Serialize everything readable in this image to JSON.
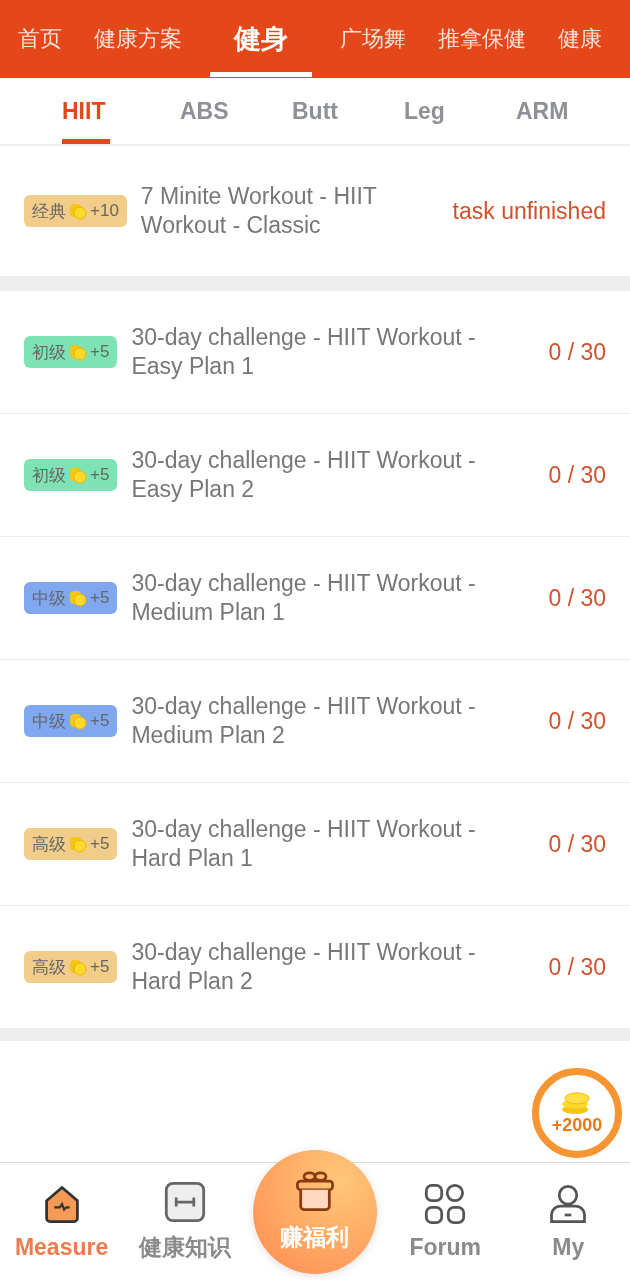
{
  "top_tabs": [
    {
      "label": "首页",
      "selected": false
    },
    {
      "label": "健康方案",
      "selected": false
    },
    {
      "label": "健身",
      "selected": true
    },
    {
      "label": "广场舞",
      "selected": false
    },
    {
      "label": "推拿保健",
      "selected": false
    },
    {
      "label": "健康",
      "selected": false
    }
  ],
  "sub_tabs": [
    {
      "label": "HIIT",
      "selected": true
    },
    {
      "label": "ABS",
      "selected": false
    },
    {
      "label": "Butt",
      "selected": false
    },
    {
      "label": "Leg",
      "selected": false
    },
    {
      "label": "ARM",
      "selected": false
    }
  ],
  "classic": {
    "badge": {
      "level": "经典",
      "reward": "+10",
      "color": "#f2cd8a"
    },
    "title": "7 Minite Workout - HIIT Workout - Classic",
    "status": "task unfinished"
  },
  "plans": [
    {
      "badge": {
        "level": "初级",
        "reward": "+5",
        "color": "#7ee3b4"
      },
      "title": "30-day challenge - HIIT Workout - Easy Plan 1",
      "progress": "0 / 30"
    },
    {
      "badge": {
        "level": "初级",
        "reward": "+5",
        "color": "#7ee3b4"
      },
      "title": "30-day challenge - HIIT Workout - Easy Plan 2",
      "progress": "0 / 30"
    },
    {
      "badge": {
        "level": "中级",
        "reward": "+5",
        "color": "#7fa8f0"
      },
      "title": "30-day challenge - HIIT Workout - Medium Plan 1",
      "progress": "0 / 30"
    },
    {
      "badge": {
        "level": "中级",
        "reward": "+5",
        "color": "#7fa8f0"
      },
      "title": "30-day challenge - HIIT Workout - Medium Plan 2",
      "progress": "0 / 30"
    },
    {
      "badge": {
        "level": "高级",
        "reward": "+5",
        "color": "#f2cd8a"
      },
      "title": "30-day challenge - HIIT Workout - Hard Plan 1",
      "progress": "0 / 30"
    },
    {
      "badge": {
        "level": "高级",
        "reward": "+5",
        "color": "#f2cd8a"
      },
      "title": "30-day challenge - HIIT Workout - Hard Plan 2",
      "progress": "0 / 30"
    }
  ],
  "coin_bubble": "+2000",
  "bottom_nav": [
    {
      "kind": "measure",
      "label": "Measure",
      "selected": true
    },
    {
      "kind": "knowledge",
      "label": "健康知识",
      "selected": false
    },
    {
      "kind": "gift",
      "label": "赚福利",
      "selected": false
    },
    {
      "kind": "forum",
      "label": "Forum",
      "selected": false
    },
    {
      "kind": "my",
      "label": "My",
      "selected": false
    }
  ]
}
